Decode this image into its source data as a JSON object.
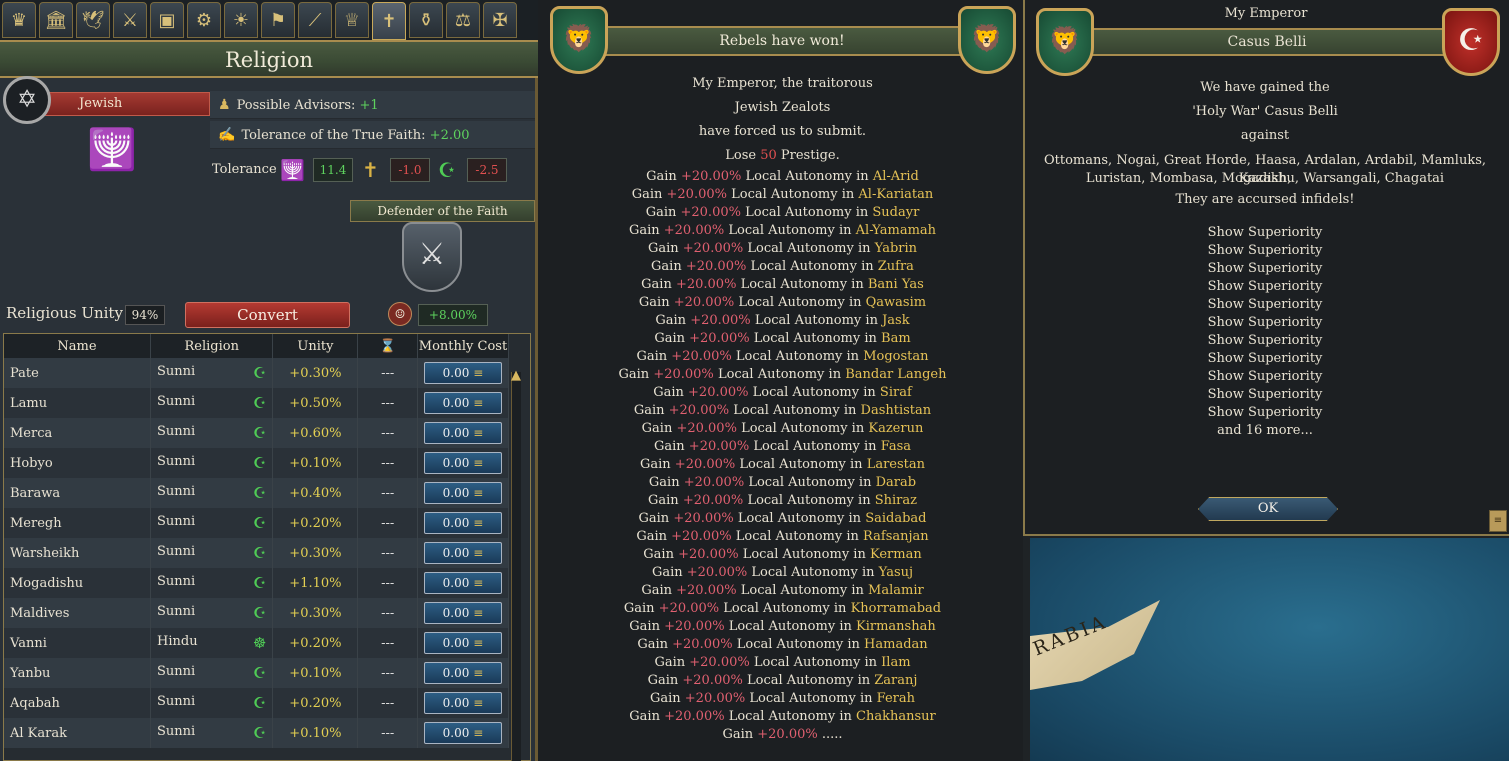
{
  "tabs": [
    "crown-icon",
    "building-icon",
    "dove-icon",
    "army-icon",
    "trade-icon",
    "gear-icon",
    "idea-icon",
    "estate-icon",
    "telescope-icon",
    "crown2-icon",
    "cross-icon",
    "pot-icon",
    "court-icon",
    "military-icon"
  ],
  "religion_panel": {
    "title": "Religion",
    "religion_name": "Jewish",
    "possible_advisors_label": "Possible Advisors:",
    "possible_advisors_value": "+1",
    "tolerance_true_label": "Tolerance of the True Faith:",
    "tolerance_true_value": "+2.00",
    "tolerance_label": "Tolerance",
    "tolerance_values": [
      "11.4",
      "-1.0",
      "-2.5"
    ],
    "defender_label": "Defender of the Faith",
    "unity_label": "Religious Unity",
    "unity_value": "94%",
    "convert_label": "Convert",
    "convert_value": "+8.00%",
    "table_headers": [
      "Name",
      "Religion",
      "Unity",
      "⌛",
      "Monthly Cost"
    ],
    "rows": [
      {
        "name": "Pate",
        "religion": "Sunni",
        "unity": "+0.30%",
        "dash": "---",
        "cost": "0.00"
      },
      {
        "name": "Lamu",
        "religion": "Sunni",
        "unity": "+0.50%",
        "dash": "---",
        "cost": "0.00"
      },
      {
        "name": "Merca",
        "religion": "Sunni",
        "unity": "+0.60%",
        "dash": "---",
        "cost": "0.00"
      },
      {
        "name": "Hobyo",
        "religion": "Sunni",
        "unity": "+0.10%",
        "dash": "---",
        "cost": "0.00"
      },
      {
        "name": "Barawa",
        "religion": "Sunni",
        "unity": "+0.40%",
        "dash": "---",
        "cost": "0.00"
      },
      {
        "name": "Meregh",
        "religion": "Sunni",
        "unity": "+0.20%",
        "dash": "---",
        "cost": "0.00"
      },
      {
        "name": "Warsheikh",
        "religion": "Sunni",
        "unity": "+0.30%",
        "dash": "---",
        "cost": "0.00"
      },
      {
        "name": "Mogadishu",
        "religion": "Sunni",
        "unity": "+1.10%",
        "dash": "---",
        "cost": "0.00"
      },
      {
        "name": "Maldives",
        "religion": "Sunni",
        "unity": "+0.30%",
        "dash": "---",
        "cost": "0.00"
      },
      {
        "name": "Vanni",
        "religion": "Hindu",
        "unity": "+0.20%",
        "dash": "---",
        "cost": "0.00"
      },
      {
        "name": "Yanbu",
        "religion": "Sunni",
        "unity": "+0.10%",
        "dash": "---",
        "cost": "0.00"
      },
      {
        "name": "Aqabah",
        "religion": "Sunni",
        "unity": "+0.20%",
        "dash": "---",
        "cost": "0.00"
      },
      {
        "name": "Al Karak",
        "religion": "Sunni",
        "unity": "+0.10%",
        "dash": "---",
        "cost": "0.00"
      }
    ]
  },
  "rebels_panel": {
    "title": "Rebels have won!",
    "intro": [
      "My Emperor, the traitorous",
      "Jewish Zealots",
      "have forced us to submit."
    ],
    "prestige_pre": "Lose",
    "prestige_value": "50",
    "prestige_post": "Prestige.",
    "gain_word": "Gain",
    "gain_value": "+20.00%",
    "autonomy_text": "Local Autonomy in",
    "provinces": [
      "Al-Arid",
      "Al-Kariatan",
      "Sudayr",
      "Al-Yamamah",
      "Yabrin",
      "Zufra",
      "Bani Yas",
      "Qawasim",
      "Jask",
      "Bam",
      "Mogostan",
      "Bandar Langeh",
      "Siraf",
      "Dashtistan",
      "Kazerun",
      "Fasa",
      "Larestan",
      "Darab",
      "Shiraz",
      "Saidabad",
      "Rafsanjan",
      "Kerman",
      "Yasuj",
      "Malamir",
      "Khorramabad",
      "Kirmanshah",
      "Hamadan",
      "Ilam",
      "Zaranj",
      "Ferah",
      "Chakhansur"
    ],
    "last_line_suffix": "....."
  },
  "casus_belli_panel": {
    "header": "My Emperor",
    "title": "Casus Belli",
    "line1": "We have gained the",
    "line2": "'Holy War' Casus Belli",
    "line3": "against",
    "targets_1": "Ottomans, Nogai, Great Horde, Haasa, Ardalan, Ardabil, Mamluks, Kazakh,",
    "targets_2": "Luristan, Mombasa, Mogadishu, Warsangali, Chagatai",
    "line4": "They are accursed infidels!",
    "superiority": [
      "Show Superiority",
      "Show Superiority",
      "Show Superiority",
      "Show Superiority",
      "Show Superiority",
      "Show Superiority",
      "Show Superiority",
      "Show Superiority",
      "Show Superiority",
      "Show Superiority",
      "Show Superiority"
    ],
    "more": "and 16 more...",
    "ok_label": "OK"
  },
  "map": {
    "region_label": "RABIA"
  },
  "colors": {
    "accent_gold": "#e6c256",
    "positive_green": "#5ed35e",
    "negative_red": "#e05050",
    "unity_yellow": "#e4d052"
  }
}
